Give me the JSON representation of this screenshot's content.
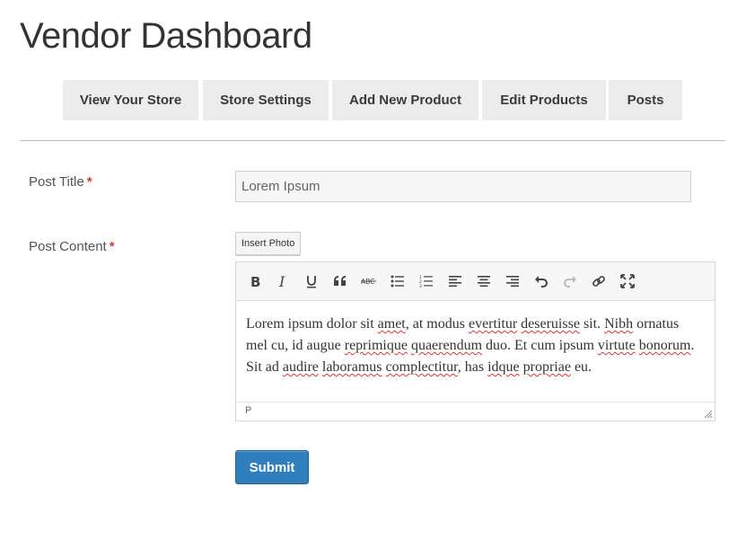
{
  "page": {
    "title": "Vendor Dashboard"
  },
  "nav": {
    "items": [
      {
        "label": "View Your Store"
      },
      {
        "label": "Store Settings"
      },
      {
        "label": "Add New Product"
      },
      {
        "label": "Edit Products"
      },
      {
        "label": "Posts"
      }
    ]
  },
  "form": {
    "post_title": {
      "label": "Post Title",
      "required": "*",
      "value": "Lorem Ipsum"
    },
    "post_content": {
      "label": "Post Content",
      "required": "*",
      "insert_photo_label": "Insert Photo",
      "toolbar": [
        "bold-icon",
        "italic-icon",
        "underline-icon",
        "blockquote-icon",
        "strikethrough-icon",
        "bullet-list-icon",
        "numbered-list-icon",
        "align-left-icon",
        "align-center-icon",
        "align-right-icon",
        "undo-icon",
        "redo-icon",
        "link-icon",
        "fullscreen-icon"
      ],
      "body": {
        "w1": "Lorem ipsum dolor sit ",
        "s1": "amet",
        "w2": ", at modus ",
        "s2": "evertitur",
        "w3": " ",
        "s3": "deseruisse",
        "w4": " sit. ",
        "s4": "Nibh",
        "w5": " ornatus mel cu, id augue ",
        "s5": "reprimique",
        "w6": " ",
        "s6": "quaerendum",
        "w7": " duo. Et cum ipsum ",
        "s7": "virtute",
        "w8": " ",
        "s8": "bonorum",
        "w9": ". Sit ad ",
        "s9": "audire",
        "w10": " ",
        "s10": "laboramus",
        "w11": " ",
        "s11": "complectitur",
        "w12": ", has ",
        "s12": "idque",
        "w13": " ",
        "s13": "propriae",
        "w14": " eu."
      },
      "status_path": "P"
    },
    "submit_label": "Submit"
  },
  "colors": {
    "accent": "#2f7fbf",
    "required": "#dd3333",
    "nav_bg": "#ececec"
  }
}
